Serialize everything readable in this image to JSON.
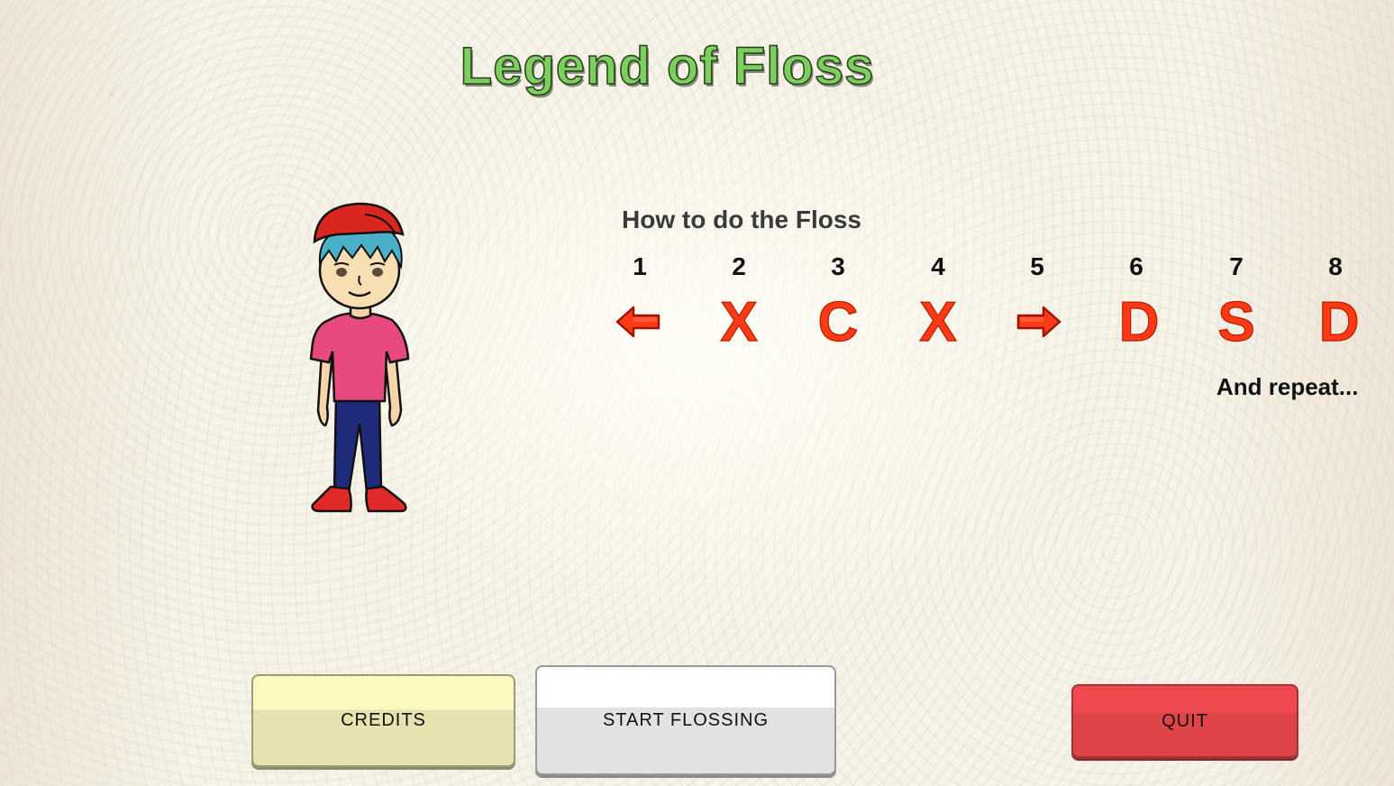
{
  "title": "Legend of Floss",
  "instructions": {
    "heading": "How to do the Floss",
    "steps": [
      {
        "number": "1",
        "symbol": "",
        "icon": "left-arrow-icon"
      },
      {
        "number": "2",
        "symbol": "X"
      },
      {
        "number": "3",
        "symbol": "C"
      },
      {
        "number": "4",
        "symbol": "X"
      },
      {
        "number": "5",
        "symbol": "",
        "icon": "right-arrow-icon"
      },
      {
        "number": "6",
        "symbol": "D"
      },
      {
        "number": "7",
        "symbol": "S"
      },
      {
        "number": "8",
        "symbol": "D"
      }
    ],
    "footer": "And repeat..."
  },
  "buttons": {
    "credits": "CREDITS",
    "start": "START FLOSSING",
    "quit": "QUIT"
  },
  "colors": {
    "title": "#7bcf5d",
    "key_symbols": "#ff3a14",
    "quit_button": "#e5474c",
    "credits_button": "#ede9b8"
  }
}
